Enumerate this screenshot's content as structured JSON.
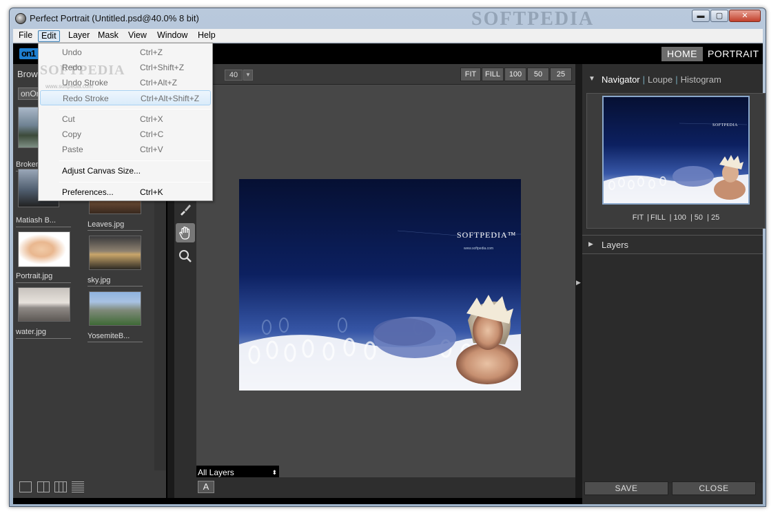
{
  "window": {
    "title": "Perfect Portrait (Untitled.psd@40.0% 8 bit)",
    "watermark": "SOFTPEDIA",
    "controls": {
      "minimize": "▬",
      "maximize": "▢",
      "close": "✕"
    }
  },
  "menubar": {
    "items": [
      "File",
      "Edit",
      "Layer",
      "Mask",
      "View",
      "Window",
      "Help"
    ],
    "active": "Edit"
  },
  "header": {
    "logo": "on1",
    "tabs": {
      "home": "HOME",
      "portrait": "PORTRAIT"
    }
  },
  "browser": {
    "title": "Brow",
    "folder": "onOn",
    "thumbnails": [
      {
        "label": "Broken"
      },
      {
        "label": "Matiash B..."
      },
      {
        "label": "Leaves.jpg"
      },
      {
        "label": "Portrait.jpg"
      },
      {
        "label": "sky.jpg"
      },
      {
        "label": "water.jpg"
      },
      {
        "label": "YosemiteB..."
      }
    ]
  },
  "canvas": {
    "zoom_value": "40",
    "zoom_buttons": [
      "FIT",
      "FILL",
      "100",
      "50",
      "25"
    ],
    "layer_select": "All Layers",
    "text_tool": "A",
    "photo_brand": "SOFTPEDIA™",
    "photo_url": "www.softpedia.com"
  },
  "tools": {
    "brush_icon": "brush-icon",
    "hand_icon": "hand-icon",
    "zoom_icon": "magnifier-icon"
  },
  "rightpanel": {
    "nav_tabs": [
      "Navigator",
      "Loupe",
      "Histogram"
    ],
    "nav_zoom": [
      "FIT",
      "FILL",
      "100",
      "50",
      "25"
    ],
    "layers_label": "Layers",
    "save_label": "SAVE",
    "close_label": "CLOSE"
  },
  "edit_menu": {
    "watermark": "SOFTPEDIA",
    "watermark_url": "www.softpedia.com",
    "items": [
      {
        "label": "Undo",
        "shortcut": "Ctrl+Z",
        "enabled": false
      },
      {
        "label": "Redo",
        "shortcut": "Ctrl+Shift+Z",
        "enabled": false
      },
      {
        "label": "Undo Stroke",
        "shortcut": "Ctrl+Alt+Z",
        "enabled": false
      },
      {
        "label": "Redo Stroke",
        "shortcut": "Ctrl+Alt+Shift+Z",
        "enabled": false,
        "hover": true
      },
      {
        "label": "Cut",
        "shortcut": "Ctrl+X",
        "enabled": false
      },
      {
        "label": "Copy",
        "shortcut": "Ctrl+C",
        "enabled": false
      },
      {
        "label": "Paste",
        "shortcut": "Ctrl+V",
        "enabled": false
      },
      {
        "label": "Adjust Canvas Size...",
        "shortcut": "",
        "enabled": true
      },
      {
        "label": "Preferences...",
        "shortcut": "Ctrl+K",
        "enabled": true
      }
    ]
  },
  "colors": {
    "accent_highlight": "#dce9f6",
    "app_background": "#2e2e2e",
    "close_button": "#c2402b"
  }
}
